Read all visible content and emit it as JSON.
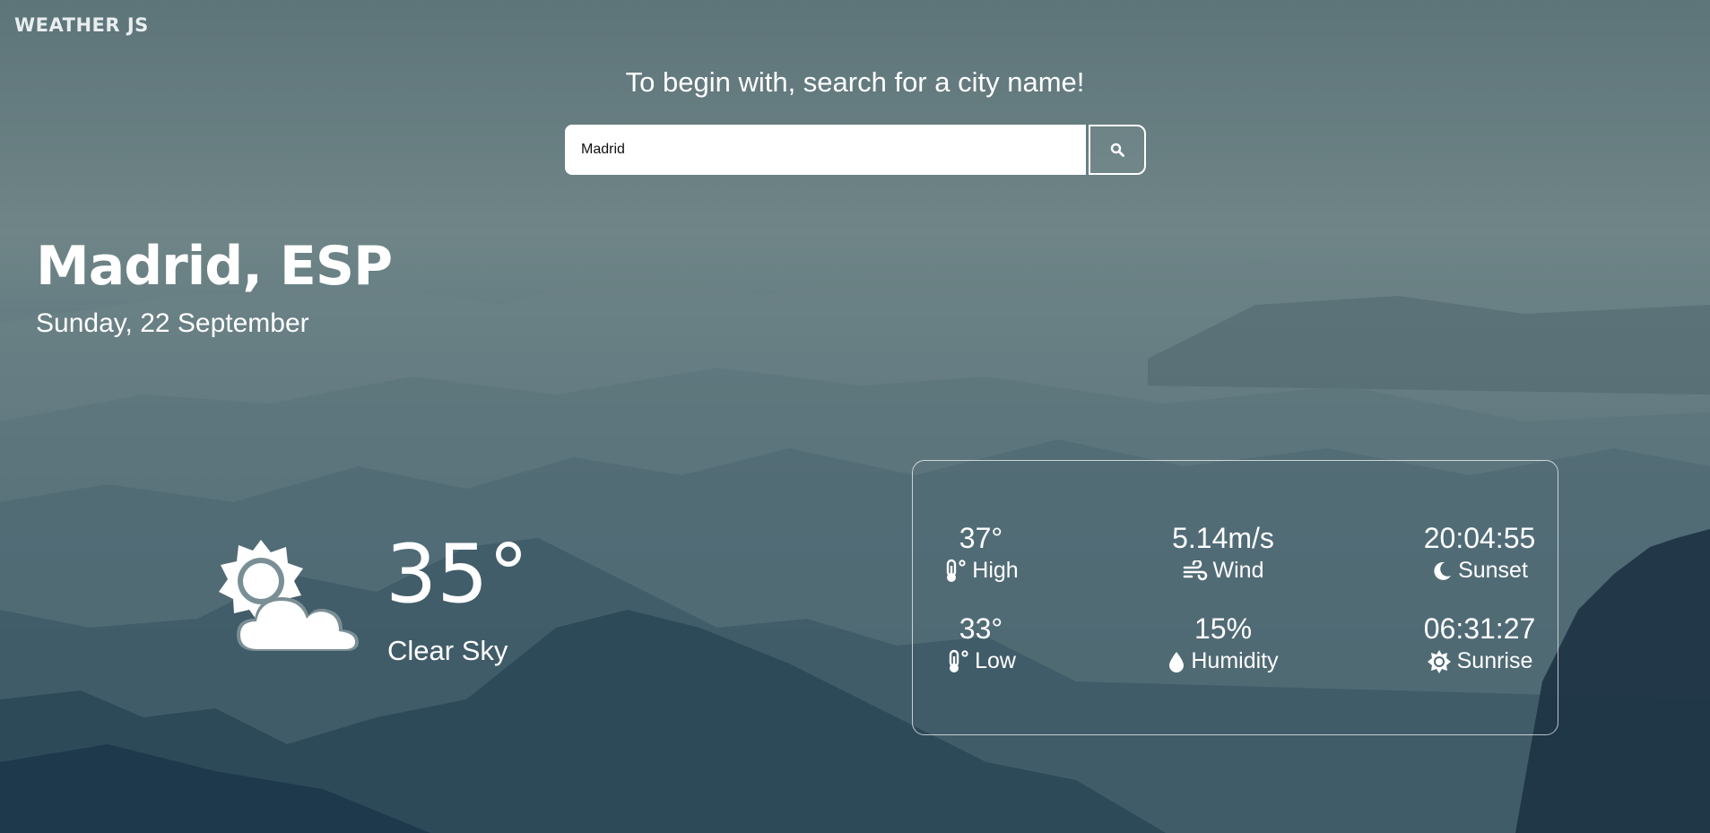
{
  "app": {
    "logo": "WEATHER JS"
  },
  "search": {
    "prompt": "To begin with, search for a city name!",
    "value": "Madrid",
    "button_icon": "search-icon"
  },
  "location": {
    "city": "Madrid, ESP",
    "date": "Sunday, 22 September"
  },
  "current": {
    "icon": "partly-cloudy-icon",
    "temperature": "35°",
    "description": "Clear Sky"
  },
  "details": {
    "high": {
      "value": "37°",
      "label": "High",
      "icon": "thermometer-icon"
    },
    "low": {
      "value": "33°",
      "label": "Low",
      "icon": "thermometer-icon"
    },
    "wind": {
      "value": "5.14m/s",
      "label": "Wind",
      "icon": "wind-icon"
    },
    "humidity": {
      "value": "15%",
      "label": "Humidity",
      "icon": "droplet-icon"
    },
    "sunset": {
      "value": "20:04:55",
      "label": "Sunset",
      "icon": "moon-icon"
    },
    "sunrise": {
      "value": "06:31:27",
      "label": "Sunrise",
      "icon": "sun-icon"
    }
  },
  "colors": {
    "text": "#ffffff",
    "input_bg": "#ffffff",
    "panel_border": "#ffffff"
  }
}
